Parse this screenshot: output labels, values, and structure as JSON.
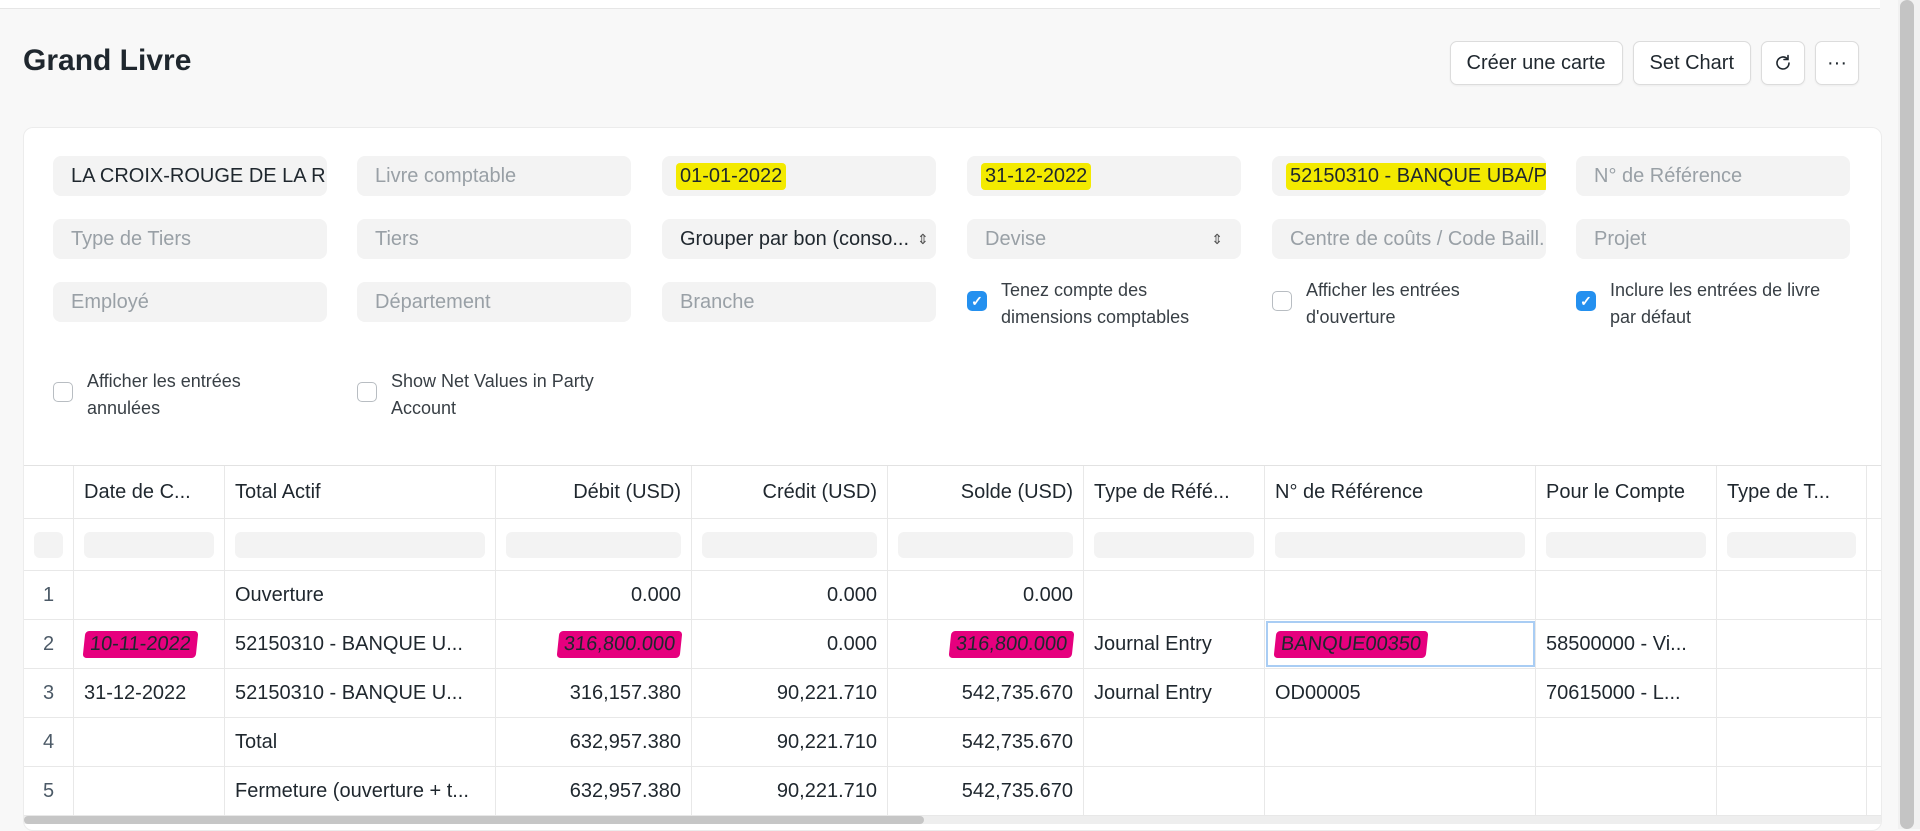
{
  "page_title": "Grand Livre",
  "actions": {
    "create_card": "Créer une carte",
    "set_chart": "Set Chart",
    "refresh_icon": "refresh-icon",
    "more_icon": "more-icon",
    "more_glyph": "···"
  },
  "filters": {
    "company": "LA CROIX-ROUGE DE LA R",
    "finance_book_placeholder": "Livre comptable",
    "from_date": "01-01-2022",
    "to_date": "31-12-2022",
    "account": "52150310 - BANQUE UBA/P...",
    "reference_placeholder": "N° de Référence",
    "party_type_placeholder": "Type de Tiers",
    "party_placeholder": "Tiers",
    "group_by": "Grouper par bon (conso...",
    "currency_placeholder": "Devise",
    "cost_center_placeholder": "Centre de coûts / Code Baill...",
    "project_placeholder": "Projet",
    "employee_placeholder": "Employé",
    "department_placeholder": "Département",
    "branch_placeholder": "Branche"
  },
  "checks": [
    {
      "line1": "Tenez compte des",
      "line2": "dimensions comptables",
      "checked": true
    },
    {
      "line1": "Afficher les entrées",
      "line2": "d'ouverture",
      "checked": false
    },
    {
      "line1": "Inclure les entrées de livre",
      "line2": "par défaut",
      "checked": true
    },
    {
      "line1": "Afficher les entrées",
      "line2": "annulées",
      "checked": false
    },
    {
      "line1": "Show Net Values in Party",
      "line2": "Account",
      "checked": false
    }
  ],
  "check_glyph": "✓",
  "highlight_color": "#f3ea00",
  "mark_color": "#e6007e",
  "table": {
    "columns": [
      "Date de C...",
      "Total Actif",
      "Débit (USD)",
      "Crédit (USD)",
      "Solde (USD)",
      "Type de Réfé...",
      "N° de Référence",
      "Pour le Compte",
      "Type de T..."
    ],
    "rows": [
      {
        "idx": "1",
        "date": "",
        "account": "Ouverture",
        "debit": "0.000",
        "credit": "0.000",
        "balance": "0.000",
        "vtype": "",
        "ref": "",
        "against": "",
        "ptype": ""
      },
      {
        "idx": "2",
        "date": "10-11-2022",
        "account": "52150310 - BANQUE U...",
        "debit": "316,800.000",
        "credit": "0.000",
        "balance": "316,800.000",
        "vtype": "Journal Entry",
        "ref": "BANQUE00350",
        "against": "58500000 - Vi...",
        "ptype": ""
      },
      {
        "idx": "3",
        "date": "31-12-2022",
        "account": "52150310 - BANQUE U...",
        "debit": "316,157.380",
        "credit": "90,221.710",
        "balance": "542,735.670",
        "vtype": "Journal Entry",
        "ref": "OD00005",
        "against": "70615000 - L...",
        "ptype": ""
      },
      {
        "idx": "4",
        "date": "",
        "account": "Total",
        "debit": "632,957.380",
        "credit": "90,221.710",
        "balance": "542,735.670",
        "vtype": "",
        "ref": "",
        "against": "",
        "ptype": ""
      },
      {
        "idx": "5",
        "date": "",
        "account": "Fermeture (ouverture + t...",
        "debit": "632,957.380",
        "credit": "90,221.710",
        "balance": "542,735.670",
        "vtype": "",
        "ref": "",
        "against": "",
        "ptype": ""
      }
    ]
  }
}
